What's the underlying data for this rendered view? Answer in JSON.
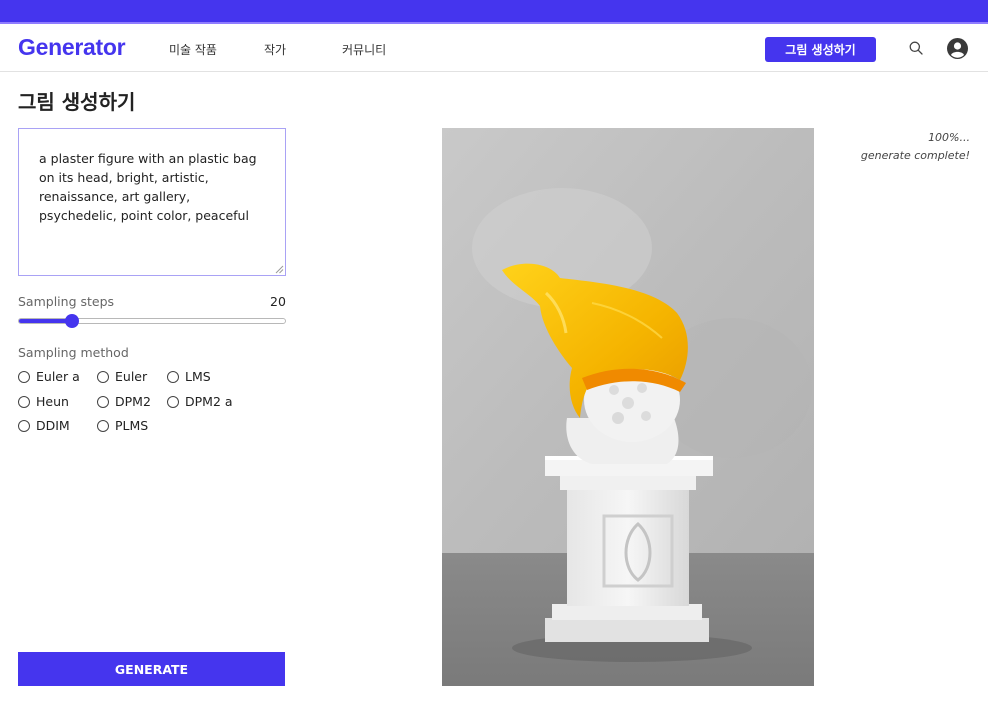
{
  "header": {
    "logo": "Generator",
    "nav": [
      "미술 작품",
      "작가",
      "커뮤니티"
    ],
    "cta_label": "그림 생성하기",
    "search_icon": "search-icon",
    "user_icon": "user-circle-icon"
  },
  "page": {
    "title": "그림 생성하기"
  },
  "form": {
    "prompt": "a plaster figure with an plastic bag on its head, bright, artistic, renaissance, art gallery, psychedelic, point color, peaceful",
    "steps_label": "Sampling  steps",
    "steps_value": "20",
    "steps_fraction": 0.2,
    "method_label": "Sampling  method",
    "methods": [
      "Euler a",
      "Euler",
      "LMS",
      "Heun",
      "DPM2",
      "DPM2 a",
      "DDIM",
      "PLMS"
    ],
    "generate_label": "GENERATE"
  },
  "status": {
    "progress": "100%...",
    "message": "generate complete!"
  },
  "colors": {
    "accent": "#4535ee",
    "accent_light": "#a9a2f5"
  }
}
